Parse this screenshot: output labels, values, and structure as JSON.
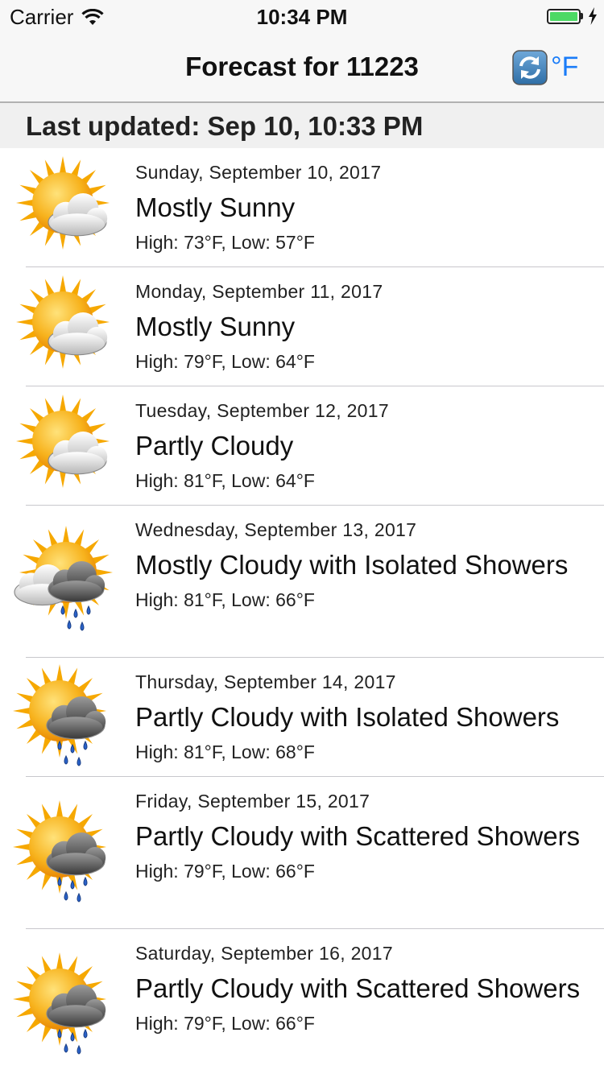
{
  "status_bar": {
    "carrier": "Carrier",
    "time": "10:34 PM",
    "battery_color": "#4cd964",
    "icons": [
      "wifi-icon",
      "battery-icon",
      "charging-bolt-icon"
    ]
  },
  "nav_bar": {
    "title": "Forecast for 11223",
    "refresh_icon": "refresh-icon",
    "unit_label": "°F",
    "accent_color": "#1a7cf8"
  },
  "section_header": {
    "label": "Last updated: Sep 10, 10:33 PM"
  },
  "forecast": [
    {
      "date": "Sunday, September 10, 2017",
      "condition": "Mostly Sunny",
      "temps": "High: 73°F, Low: 57°F",
      "icon": "mostly-sunny-icon"
    },
    {
      "date": "Monday, September 11, 2017",
      "condition": "Mostly Sunny",
      "temps": "High: 79°F, Low: 64°F",
      "icon": "mostly-sunny-icon"
    },
    {
      "date": "Tuesday, September 12, 2017",
      "condition": "Partly Cloudy",
      "temps": "High: 81°F, Low: 64°F",
      "icon": "partly-cloudy-icon"
    },
    {
      "date": "Wednesday, September 13, 2017",
      "condition": "Mostly Cloudy with Isolated Showers",
      "temps": "High: 81°F, Low: 66°F",
      "icon": "mostly-cloudy-showers-icon"
    },
    {
      "date": "Thursday, September 14, 2017",
      "condition": "Partly Cloudy with Isolated Showers",
      "temps": "High: 81°F, Low: 68°F",
      "icon": "sun-cloud-showers-icon"
    },
    {
      "date": "Friday, September 15, 2017",
      "condition": "Partly Cloudy with Scattered Showers",
      "temps": "High: 79°F, Low: 66°F",
      "icon": "sun-cloud-showers-icon"
    },
    {
      "date": "Saturday, September 16, 2017",
      "condition": "Partly Cloudy with Scattered Showers",
      "temps": "High: 79°F, Low: 66°F",
      "icon": "sun-cloud-showers-icon"
    }
  ]
}
